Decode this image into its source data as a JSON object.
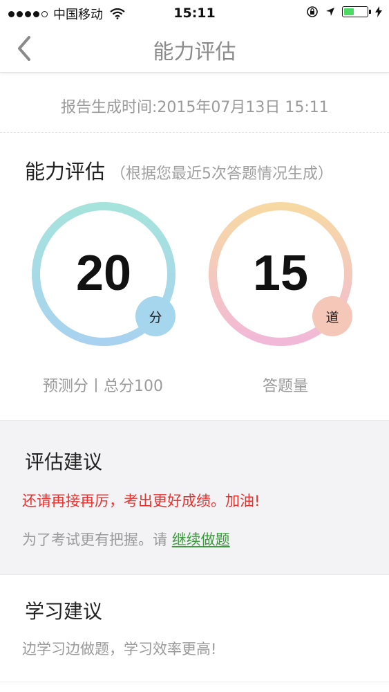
{
  "status_bar": {
    "carrier": "中国移动",
    "time": "15:11",
    "battery_level": 0.45,
    "battery_color": "#4cd964"
  },
  "nav": {
    "title": "能力评估",
    "back_icon": "chevron-left-icon"
  },
  "report": {
    "time_text": "报告生成时间:2015年07月13日  15:11"
  },
  "assessment": {
    "title": "能力评估",
    "subtitle": "（根据您最近5次答题情况生成）",
    "score": {
      "value": "20",
      "unit": "分",
      "label": "预测分丨总分100",
      "ring_colors": [
        "#a6e3dc",
        "#a8d2f0"
      ]
    },
    "questions": {
      "value": "15",
      "unit": "道",
      "label": "答题量",
      "ring_colors": [
        "#f7d9a3",
        "#f2b8d8"
      ]
    }
  },
  "advice": {
    "title": "评估建议",
    "encouragement": "还请再接再厉，考出更好成绩。加油!",
    "tip_prefix": "为了考试更有把握。请 ",
    "tip_link": "继续做题",
    "encouragement_color": "#e8322f",
    "link_color": "#3a9b3a"
  },
  "study": {
    "title": "学习建议",
    "text": "边学习边做题，学习效率更高!"
  }
}
